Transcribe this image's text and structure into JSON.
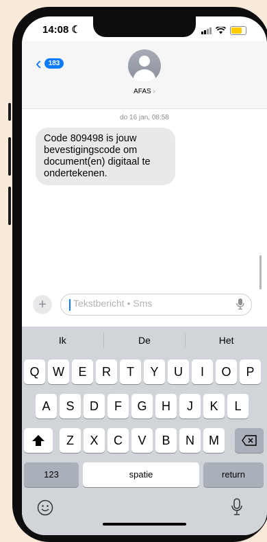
{
  "status": {
    "time": "14:08"
  },
  "header": {
    "back_count": "183",
    "contact_name": "AFAS"
  },
  "conversation": {
    "timestamp": "do 16 jan, 08:58",
    "message": "Code 809498 is jouw bevestigingscode om document(en) digitaal te ondertekenen."
  },
  "composer": {
    "placeholder": "Tekstbericht • Sms"
  },
  "keyboard": {
    "suggestions": [
      "Ik",
      "De",
      "Het"
    ],
    "row1": [
      "Q",
      "W",
      "E",
      "R",
      "T",
      "Y",
      "U",
      "I",
      "O",
      "P"
    ],
    "row2": [
      "A",
      "S",
      "D",
      "F",
      "G",
      "H",
      "J",
      "K",
      "L"
    ],
    "row3": [
      "Z",
      "X",
      "C",
      "V",
      "B",
      "N",
      "M"
    ],
    "numbers_label": "123",
    "space_label": "spatie",
    "return_label": "return"
  },
  "colors": {
    "accent": "#0a7aff",
    "bubble": "#e9e9eb",
    "keyboard": "#d1d4d9"
  }
}
